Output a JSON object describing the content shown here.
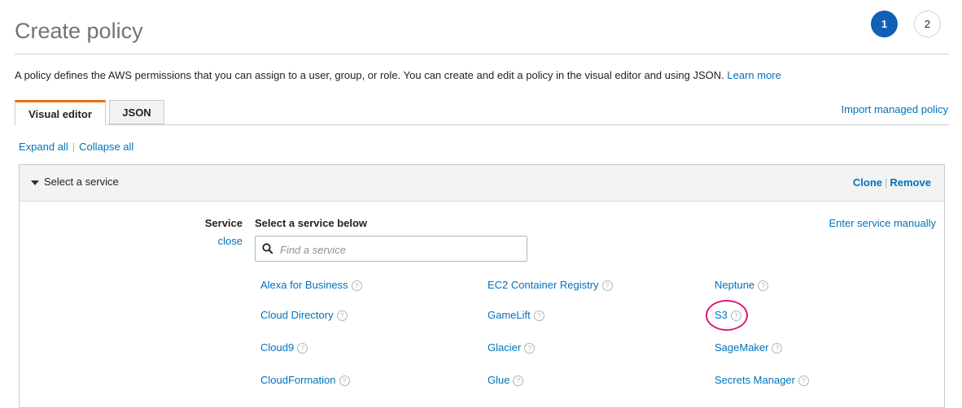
{
  "page": {
    "title": "Create policy"
  },
  "steps": [
    {
      "label": "1",
      "state": "active"
    },
    {
      "label": "2",
      "state": "inactive"
    }
  ],
  "description": {
    "text": "A policy defines the AWS permissions that you can assign to a user, group, or role. You can create and edit a policy in the visual editor and using JSON.",
    "learn_more": "Learn more"
  },
  "tabs": [
    {
      "label": "Visual editor",
      "active": true
    },
    {
      "label": "JSON",
      "active": false
    }
  ],
  "import_link": "Import managed policy",
  "expand_all": "Expand all",
  "collapse_all": "Collapse all",
  "separator": "|",
  "panel": {
    "title": "Select a service",
    "clone": "Clone",
    "remove": "Remove",
    "service_label": "Service",
    "close_link": "close",
    "select_heading": "Select a service below",
    "manual_link": "Enter service manually",
    "search": {
      "placeholder": "Find a service",
      "value": ""
    },
    "services": [
      [
        "Alexa for Business",
        "EC2 Container Registry",
        "Neptune"
      ],
      [
        "Cloud Directory",
        "GameLift",
        "S3"
      ],
      [
        "Cloud9",
        "Glacier",
        "SageMaker"
      ],
      [
        "CloudFormation",
        "Glue",
        "Secrets Manager"
      ]
    ],
    "help_glyph": "?",
    "highlighted_service": "S3"
  },
  "colors": {
    "accent_link": "#0073bb",
    "active_step": "#1060b5",
    "tab_highlight": "#ec7211",
    "annotation_ring": "#e0157b"
  }
}
